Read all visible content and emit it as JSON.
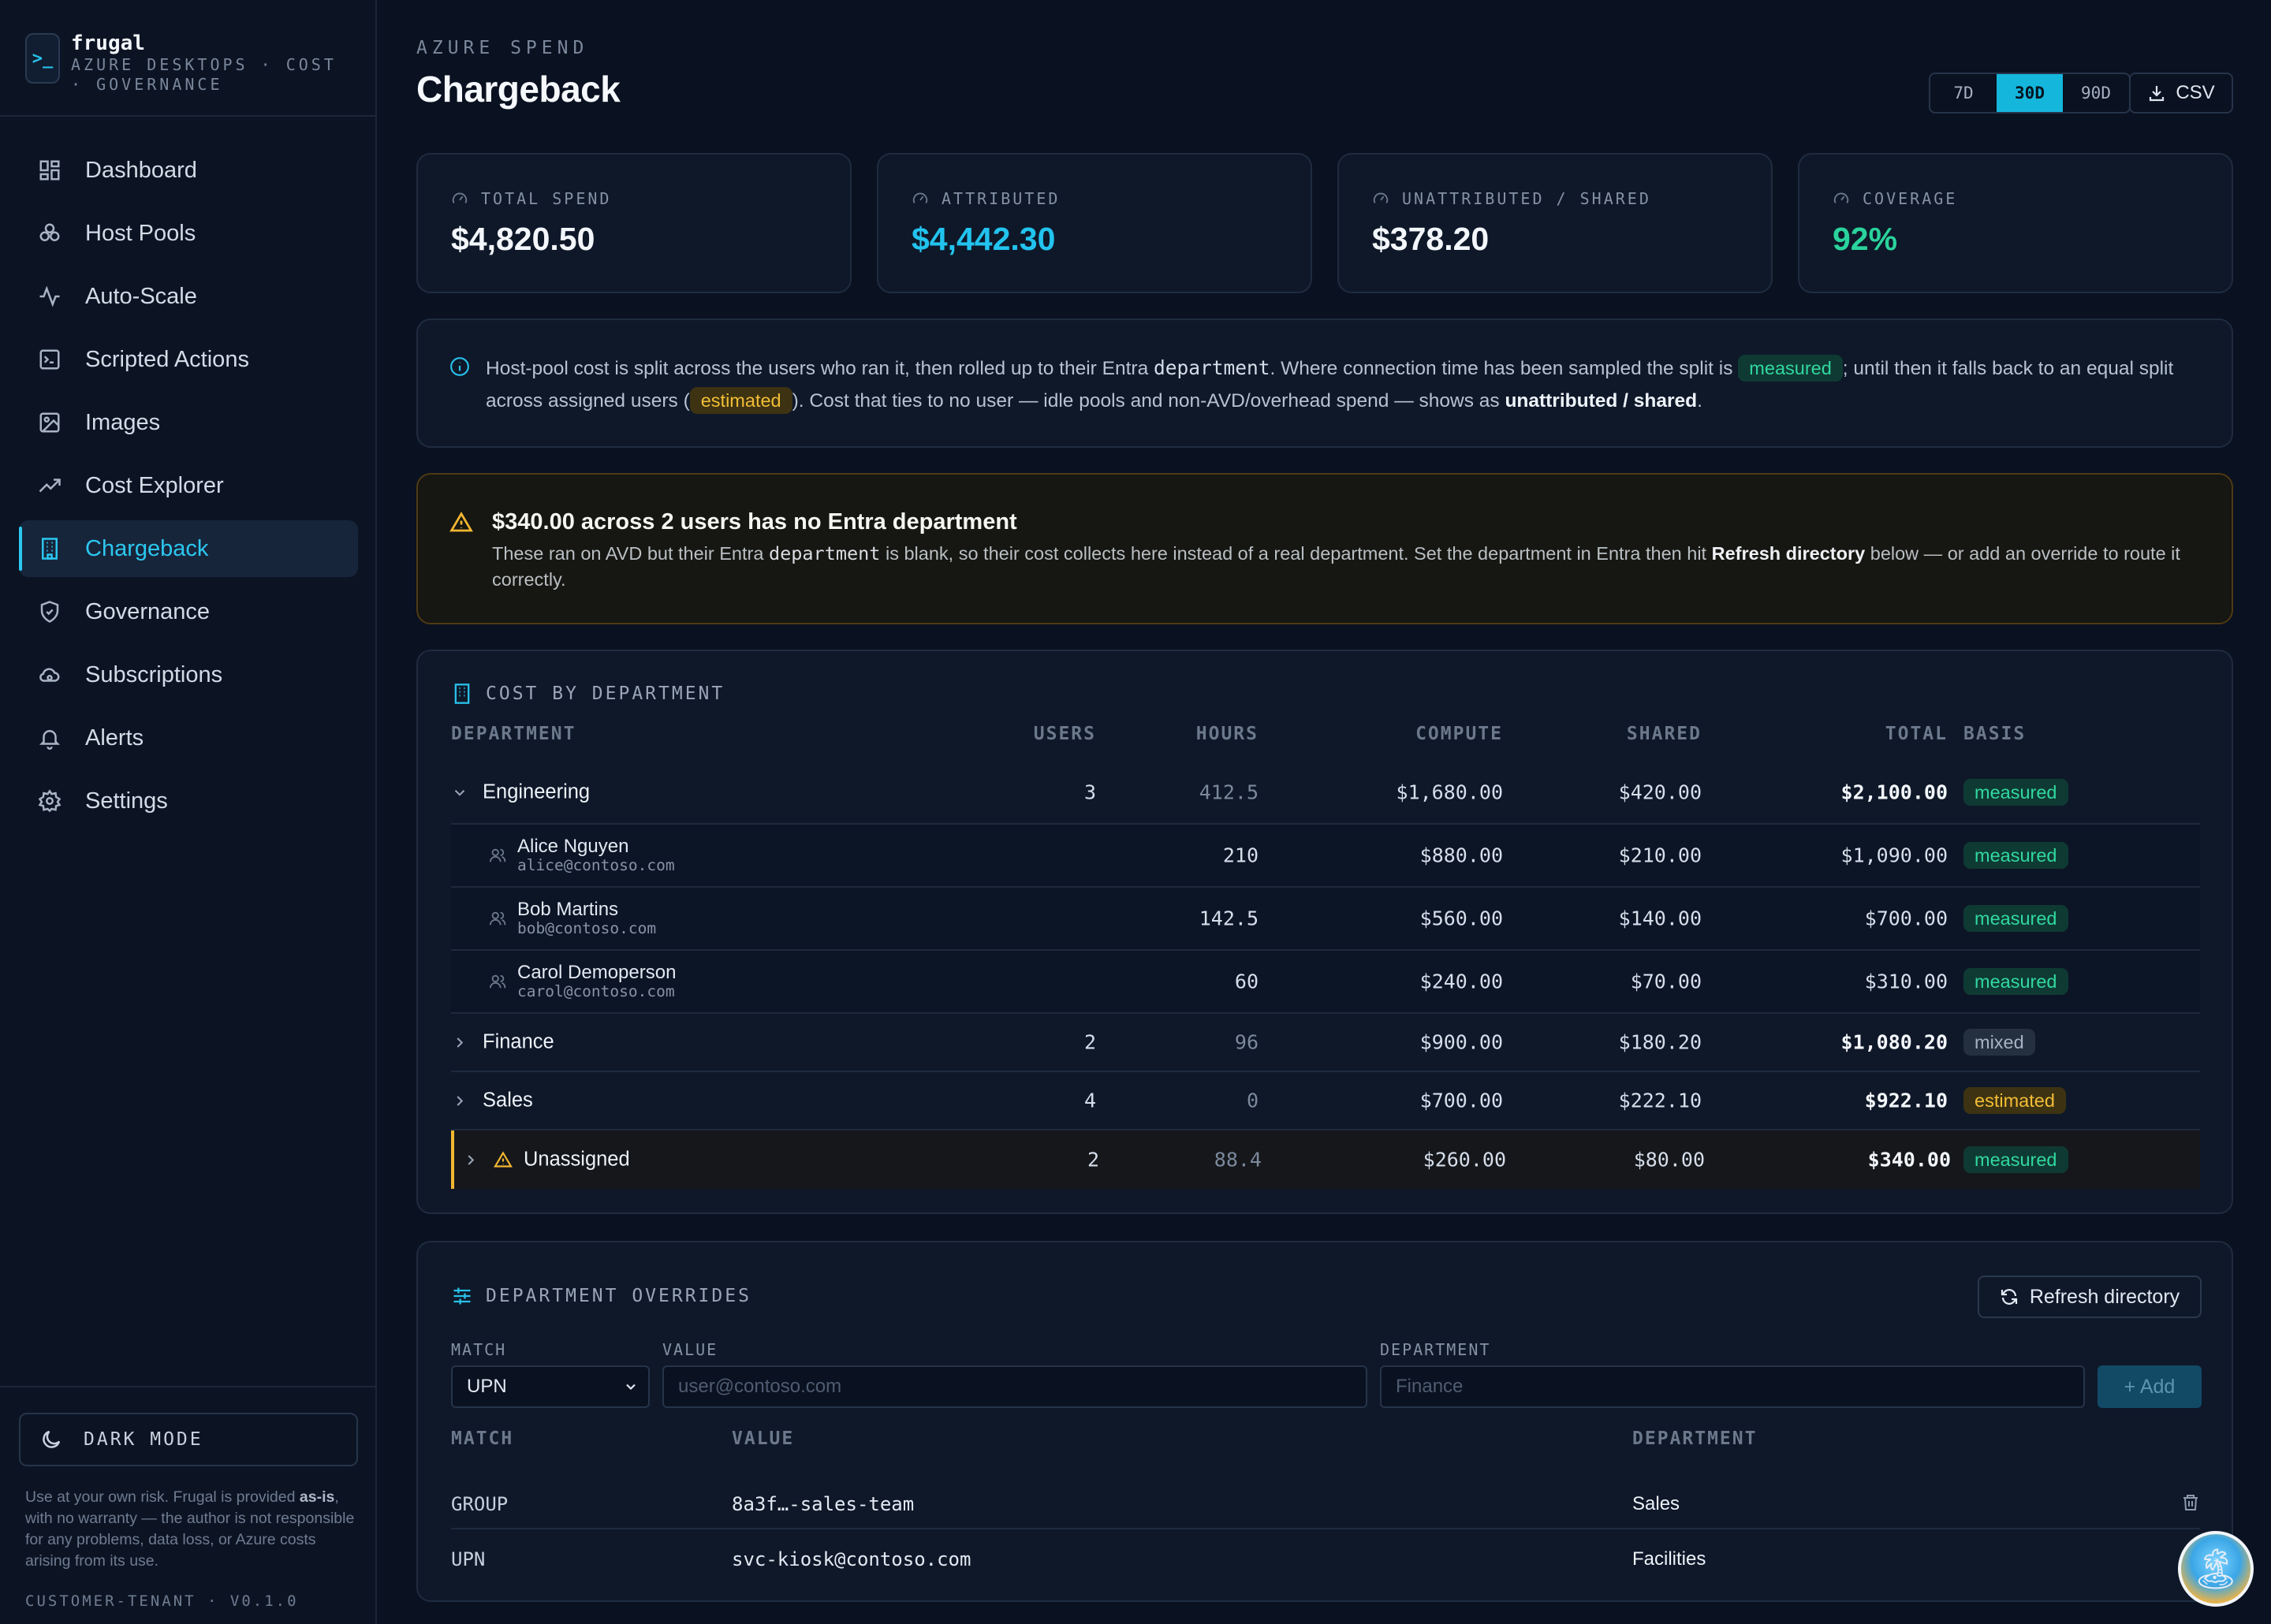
{
  "brand": {
    "icon": ">_",
    "name": "frugal",
    "subtitle": "AZURE DESKTOPS · COST · GOVERNANCE"
  },
  "nav": [
    {
      "label": "Dashboard",
      "icon": "dashboard-icon"
    },
    {
      "label": "Host Pools",
      "icon": "host-pools-icon"
    },
    {
      "label": "Auto-Scale",
      "icon": "activity-icon"
    },
    {
      "label": "Scripted Actions",
      "icon": "terminal-icon"
    },
    {
      "label": "Images",
      "icon": "image-icon"
    },
    {
      "label": "Cost Explorer",
      "icon": "trending-icon"
    },
    {
      "label": "Chargeback",
      "icon": "building-icon",
      "active": true
    },
    {
      "label": "Governance",
      "icon": "shield-icon"
    },
    {
      "label": "Subscriptions",
      "icon": "cloud-icon"
    },
    {
      "label": "Alerts",
      "icon": "bell-icon"
    },
    {
      "label": "Settings",
      "icon": "gear-icon"
    }
  ],
  "sidebar_footer": {
    "dark_mode_label": "DARK MODE",
    "disclaimer_pre": "Use at your own risk. Frugal is provided ",
    "disclaimer_bold": "as-is",
    "disclaimer_post": ", with no warranty — the author is not responsible for any problems, data loss, or Azure costs arising from its use.",
    "tenant": "CUSTOMER-TENANT · V0.1.0"
  },
  "header": {
    "eyebrow": "AZURE SPEND",
    "title": "Chargeback",
    "ranges": [
      "7D",
      "30D",
      "90D"
    ],
    "active_range": "30D",
    "csv_label": "CSV"
  },
  "stats": [
    {
      "label": "TOTAL SPEND",
      "value": "$4,820.50",
      "color": "#f3f6fa"
    },
    {
      "label": "ATTRIBUTED",
      "value": "$4,442.30",
      "color": "#22c3ee"
    },
    {
      "label": "UNATTRIBUTED / SHARED",
      "value": "$378.20",
      "color": "#f3f6fa"
    },
    {
      "label": "COVERAGE",
      "value": "92%",
      "color": "#2ad39c"
    }
  ],
  "info": {
    "t1": "Host-pool cost is split across the users who ran it, then rolled up to their Entra ",
    "code": "department",
    "t2": ". Where connection time has been sampled the split is ",
    "pill_measured": "measured",
    "t3": "; until then it falls back to an equal split across assigned users (",
    "pill_estimated": "estimated",
    "t4": "). Cost that ties to no user — idle pools and non-AVD/overhead spend — shows as ",
    "bold": "unattributed / shared",
    "t5": "."
  },
  "warning": {
    "title": "$340.00 across 2 users has no Entra department",
    "b1": "These ran on AVD but their Entra ",
    "code": "department",
    "b2": " is blank, so their cost collects here instead of a real department. Set the department in Entra then hit ",
    "bold": "Refresh directory",
    "b3": " below — or add an override to route it correctly."
  },
  "dept_table": {
    "title": "COST BY DEPARTMENT",
    "headers": {
      "department": "DEPARTMENT",
      "users": "USERS",
      "hours": "HOURS",
      "compute": "COMPUTE",
      "shared": "SHARED",
      "total": "TOTAL",
      "basis": "BASIS"
    },
    "rows": [
      {
        "kind": "dept",
        "expanded": true,
        "name": "Engineering",
        "users": "3",
        "hours": "412.5",
        "compute": "$1,680.00",
        "shared": "$420.00",
        "total": "$2,100.00",
        "basis": "measured"
      },
      {
        "kind": "user",
        "name": "Alice Nguyen",
        "email": "alice@contoso.com",
        "hours": "210",
        "compute": "$880.00",
        "shared": "$210.00",
        "total": "$1,090.00",
        "basis": "measured"
      },
      {
        "kind": "user",
        "name": "Bob Martins",
        "email": "bob@contoso.com",
        "hours": "142.5",
        "compute": "$560.00",
        "shared": "$140.00",
        "total": "$700.00",
        "basis": "measured"
      },
      {
        "kind": "user",
        "name": "Carol Demoperson",
        "email": "carol@contoso.com",
        "hours": "60",
        "compute": "$240.00",
        "shared": "$70.00",
        "total": "$310.00",
        "basis": "measured"
      },
      {
        "kind": "dept",
        "expanded": false,
        "name": "Finance",
        "users": "2",
        "hours": "96",
        "compute": "$900.00",
        "shared": "$180.20",
        "total": "$1,080.20",
        "basis": "mixed"
      },
      {
        "kind": "dept",
        "expanded": false,
        "name": "Sales",
        "users": "4",
        "hours": "0",
        "compute": "$700.00",
        "shared": "$222.10",
        "total": "$922.10",
        "basis": "estimated"
      },
      {
        "kind": "dept",
        "expanded": false,
        "warn": true,
        "name": "Unassigned",
        "users": "2",
        "hours": "88.4",
        "compute": "$260.00",
        "shared": "$80.00",
        "total": "$340.00",
        "basis": "measured"
      }
    ]
  },
  "overrides": {
    "title": "DEPARTMENT OVERRIDES",
    "refresh_label": "Refresh directory",
    "form": {
      "match_label": "MATCH",
      "match_value": "UPN",
      "value_label": "VALUE",
      "value_placeholder": "user@contoso.com",
      "dept_label": "DEPARTMENT",
      "dept_placeholder": "Finance",
      "add_label": "+ Add"
    },
    "headers": {
      "match": "MATCH",
      "value": "VALUE",
      "department": "DEPARTMENT"
    },
    "rows": [
      {
        "match": "GROUP",
        "value": "8a3f…-sales-team",
        "department": "Sales"
      },
      {
        "match": "UPN",
        "value": "svc-kiosk@contoso.com",
        "department": "Facilities"
      }
    ]
  }
}
